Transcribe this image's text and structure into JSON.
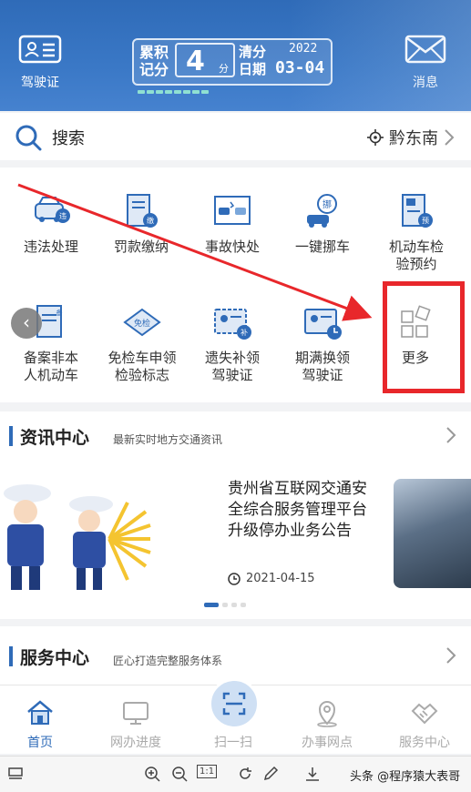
{
  "header": {
    "license_label": "驾驶证",
    "message_label": "消息",
    "score": {
      "label": "累积\n记分",
      "value": "4",
      "unit": "分",
      "clear_label": "清分\n日期",
      "year": "2022",
      "date": "03-04"
    }
  },
  "search": {
    "label": "搜索",
    "location": "黔东南"
  },
  "services": {
    "items": [
      {
        "label": "违法处理",
        "icon": "car-violation-icon"
      },
      {
        "label": "罚款缴纳",
        "icon": "fine-payment-icon"
      },
      {
        "label": "事故快处",
        "icon": "accident-icon"
      },
      {
        "label": "一键挪车",
        "icon": "move-car-icon"
      },
      {
        "label": "机动车检\n验预约",
        "icon": "inspection-booking-icon"
      },
      {
        "label": "备案非本\n人机动车",
        "icon": "register-vehicle-icon"
      },
      {
        "label": "免检车申领\n检验标志",
        "icon": "exempt-inspection-icon"
      },
      {
        "label": "遗失补领\n驾驶证",
        "icon": "reissue-license-icon"
      },
      {
        "label": "期满换领\n驾驶证",
        "icon": "renew-license-icon"
      },
      {
        "label": "更多",
        "icon": "more-icon"
      }
    ]
  },
  "news": {
    "title": "资讯中心",
    "subtitle": "最新实时地方交通资讯",
    "article_title": "贵州省互联网交通安全综合服务管理平台升级停办业务公告",
    "article_date": "2021-04-15"
  },
  "service_center": {
    "title": "服务中心",
    "subtitle": "匠心打造完整服务体系"
  },
  "bottom_nav": {
    "items": [
      {
        "label": "首页",
        "icon": "home-icon"
      },
      {
        "label": "网办进度",
        "icon": "monitor-icon"
      },
      {
        "label": "扫一扫",
        "icon": "scan-icon"
      },
      {
        "label": "办事网点",
        "icon": "location-icon"
      },
      {
        "label": "服务中心",
        "icon": "handshake-icon"
      }
    ]
  },
  "viewer": {
    "page_btn": "1:1",
    "watermark": "头条 @程序猿大表哥"
  },
  "colors": {
    "brand_blue": "#2f6bb8",
    "highlight_red": "#e8272b"
  }
}
